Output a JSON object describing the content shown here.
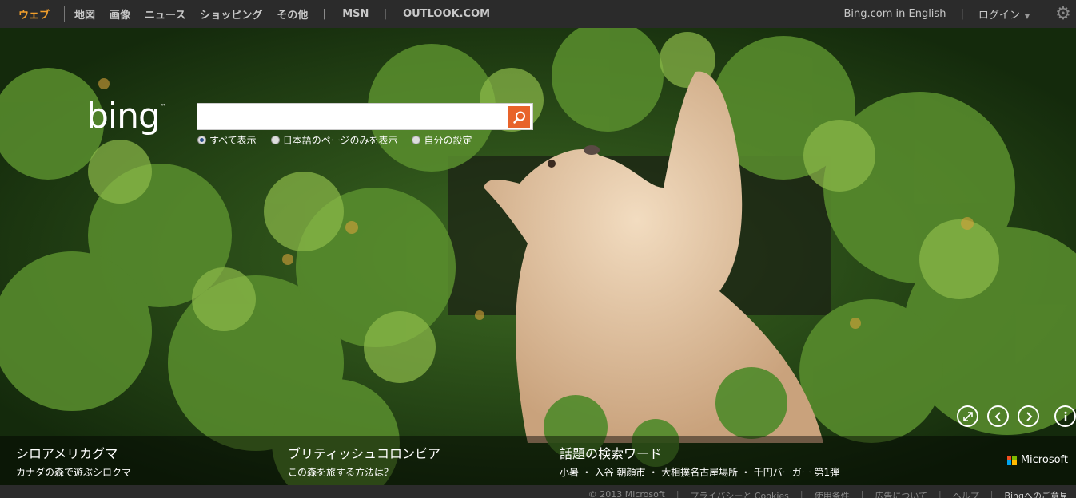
{
  "topnav": {
    "items": [
      {
        "label": "ウェブ",
        "active": true
      },
      {
        "label": "地図",
        "active": false
      },
      {
        "label": "画像",
        "active": false
      },
      {
        "label": "ニュース",
        "active": false
      },
      {
        "label": "ショッピング",
        "active": false
      },
      {
        "label": "その他",
        "active": false
      }
    ],
    "pipe": "|",
    "msn": "MSN",
    "outlook": "OUTLOOK.COM",
    "english": "Bing.com in English",
    "login": "ログイン",
    "settings_icon": "gear-icon"
  },
  "search": {
    "logo": "bing",
    "logo_tm": "™",
    "query": "",
    "button_icon": "search-icon",
    "accent": "#e8632a",
    "options": [
      {
        "label": "すべて表示",
        "selected": true
      },
      {
        "label": "日本語のページのみを表示",
        "selected": false
      },
      {
        "label": "自分の設定",
        "selected": false
      }
    ]
  },
  "controls": {
    "fullscreen_icon": "expand-icon",
    "prev_icon": "chevron-left-icon",
    "next_icon": "chevron-right-icon",
    "info_icon": "info-icon"
  },
  "hotspots": [
    {
      "title": "シロアメリカグマ",
      "sub": "カナダの森で遊ぶシロクマ"
    },
    {
      "title": "ブリティッシュコロンビア",
      "sub": "この森を旅する方法は？"
    },
    {
      "title": "話題の検索ワード",
      "sub": "小暑 ・ 入谷 朝顔市 ・ 大相撲名古屋場所 ・ 千円バーガー 第1弾"
    }
  ],
  "brand": {
    "microsoft": "Microsoft"
  },
  "footer": {
    "copyright": "© 2013 Microsoft",
    "privacy": "プライバシーと Cookies",
    "terms": "使用条件",
    "ads": "広告について",
    "help": "ヘルプ",
    "feedback": "Bingへのご意見"
  }
}
